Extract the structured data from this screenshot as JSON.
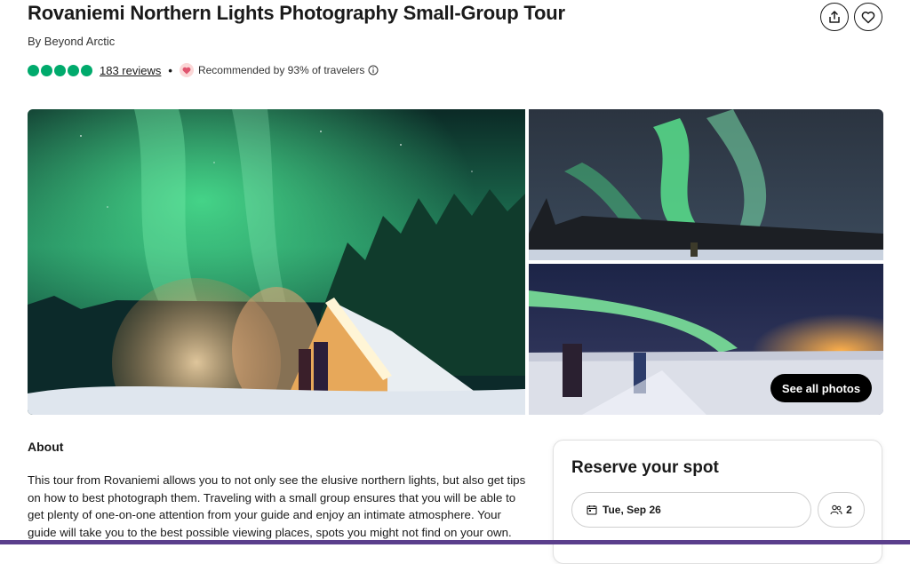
{
  "header": {
    "title": "Rovaniemi Northern Lights Photography Small-Group Tour",
    "byline": "By Beyond Arctic",
    "rating_bubbles": 5,
    "reviews_link": "183 reviews",
    "separator": "•",
    "recommendation": "Recommended by 93% of travelers",
    "share_icon": "share-icon",
    "save_icon": "heart-icon"
  },
  "gallery": {
    "see_all_label": "See all photos"
  },
  "about": {
    "heading": "About",
    "text": "This tour from Rovaniemi allows you to not only see the elusive northern lights, but also get tips on how to best photograph them. Traveling with a small group ensures that you will be able to get plenty of one-on-one attention from your guide and enjoy an intimate atmosphere. Your guide will take you to the best possible viewing places, spots you might not find on your own."
  },
  "reserve": {
    "title": "Reserve your spot",
    "date": "Tue, Sep 26",
    "travelers": "2"
  },
  "colors": {
    "rating_green": "#00aa6c",
    "heart_pink": "#e0556f",
    "aurora_green": "#3ddc84",
    "footer_purple": "#5b3f8c"
  }
}
